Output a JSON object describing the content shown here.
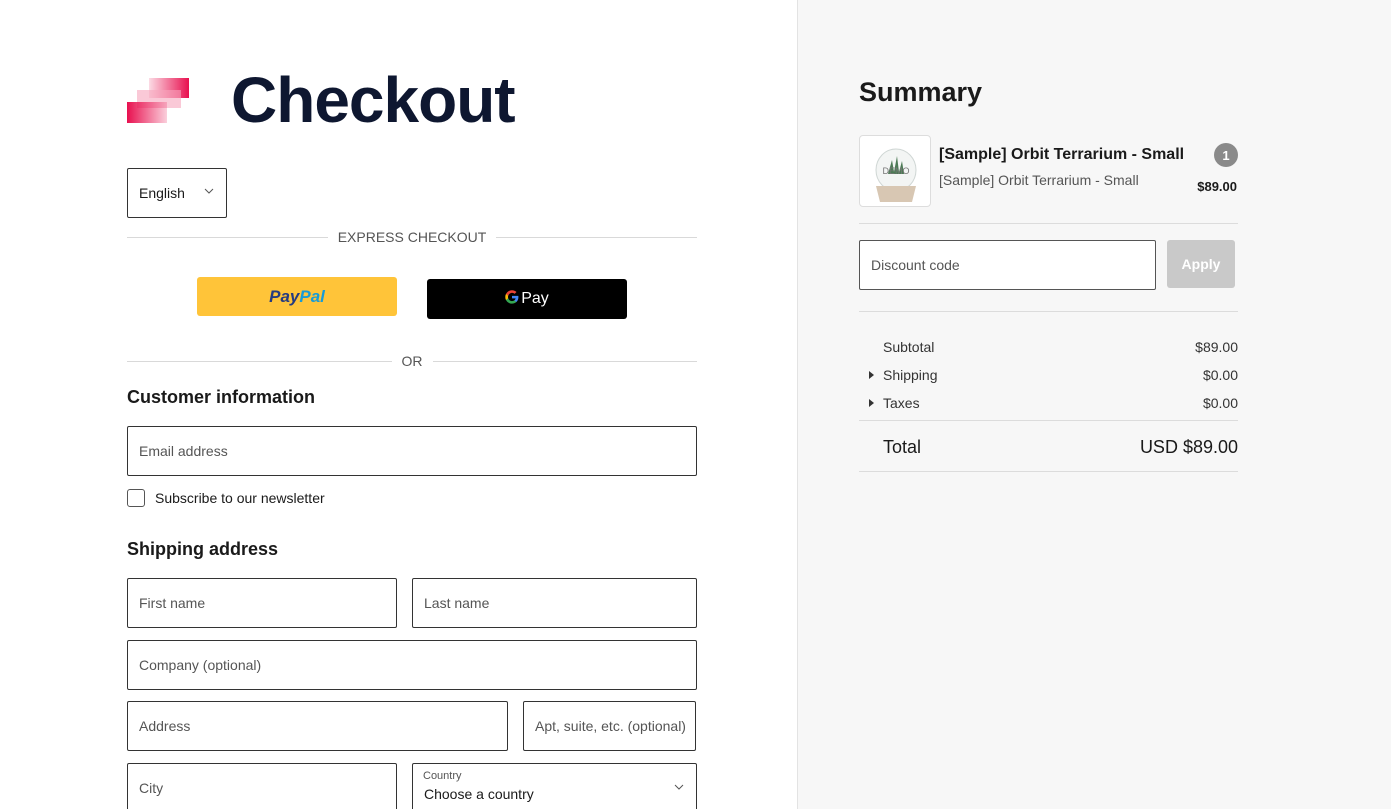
{
  "header": {
    "title": "Checkout",
    "brand_colors": {
      "primary": "#e8104f",
      "title": "#0e1730"
    }
  },
  "language": {
    "selected": "English"
  },
  "express": {
    "label": "EXPRESS CHECKOUT",
    "paypal": {
      "part1": "Pay",
      "part2": "Pal"
    },
    "gpay": {
      "g": "G",
      "label": "Pay"
    },
    "or": "OR"
  },
  "customer": {
    "heading": "Customer information",
    "email_placeholder": "Email address",
    "newsletter_label": "Subscribe to our newsletter"
  },
  "shipping": {
    "heading": "Shipping address",
    "first_name": "First name",
    "last_name": "Last name",
    "company": "Company (optional)",
    "address": "Address",
    "apt": "Apt, suite, etc. (optional)",
    "city": "City",
    "country_label": "Country",
    "country_value": "Choose a country"
  },
  "summary": {
    "title": "Summary",
    "item": {
      "name": "[Sample] Orbit Terrarium - Small",
      "variant": "[Sample] Orbit Terrarium - Small",
      "quantity": "1",
      "price": "$89.00",
      "thumbnail_text": "DEMO"
    },
    "discount_placeholder": "Discount code",
    "apply_label": "Apply",
    "subtotal_label": "Subtotal",
    "subtotal_value": "$89.00",
    "shipping_label": "Shipping",
    "shipping_value": "$0.00",
    "taxes_label": "Taxes",
    "taxes_value": "$0.00",
    "total_label": "Total",
    "total_value": "USD $89.00"
  }
}
